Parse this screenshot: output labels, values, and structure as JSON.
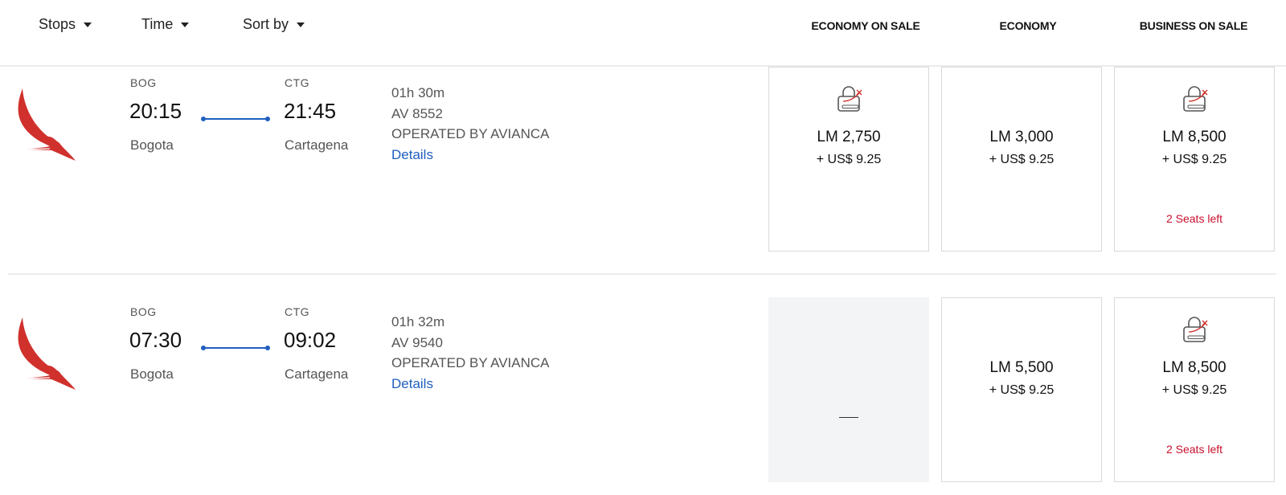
{
  "filters": [
    {
      "label": "Stops"
    },
    {
      "label": "Time"
    },
    {
      "label": "Sort by"
    }
  ],
  "columns": [
    "ECONOMY ON SALE",
    "ECONOMY",
    "BUSINESS ON SALE"
  ],
  "colors": {
    "accent_blue": "#1f5fbf",
    "alert_red": "#c8102e",
    "brand_red": "#d0312d"
  },
  "flights": [
    {
      "origin_code": "BOG",
      "origin_time": "20:15",
      "origin_city": "Bogota",
      "dest_code": "CTG",
      "dest_time": "21:45",
      "dest_city": "Cartagena",
      "duration": "01h 30m",
      "flight_number": "AV 8552",
      "operated_by": "OPERATED BY AVIANCA",
      "details_label": "Details",
      "fares": [
        {
          "available": true,
          "icon": "lock-sale-icon",
          "miles": "LM 2,750",
          "tax": "+ US$ 9.25",
          "seats": ""
        },
        {
          "available": true,
          "icon": "",
          "miles": "LM 3,000",
          "tax": "+ US$ 9.25",
          "seats": ""
        },
        {
          "available": true,
          "icon": "lock-sale-icon",
          "miles": "LM 8,500",
          "tax": "+ US$ 9.25",
          "seats": "2 Seats left"
        }
      ]
    },
    {
      "origin_code": "BOG",
      "origin_time": "07:30",
      "origin_city": "Bogota",
      "dest_code": "CTG",
      "dest_time": "09:02",
      "dest_city": "Cartagena",
      "duration": "01h 32m",
      "flight_number": "AV 9540",
      "operated_by": "OPERATED BY AVIANCA",
      "details_label": "Details",
      "fares": [
        {
          "available": false,
          "placeholder": "—"
        },
        {
          "available": true,
          "icon": "",
          "miles": "LM 5,500",
          "tax": "+ US$ 9.25",
          "seats": ""
        },
        {
          "available": true,
          "icon": "lock-sale-icon",
          "miles": "LM 8,500",
          "tax": "+ US$ 9.25",
          "seats": "2 Seats left"
        }
      ]
    }
  ]
}
